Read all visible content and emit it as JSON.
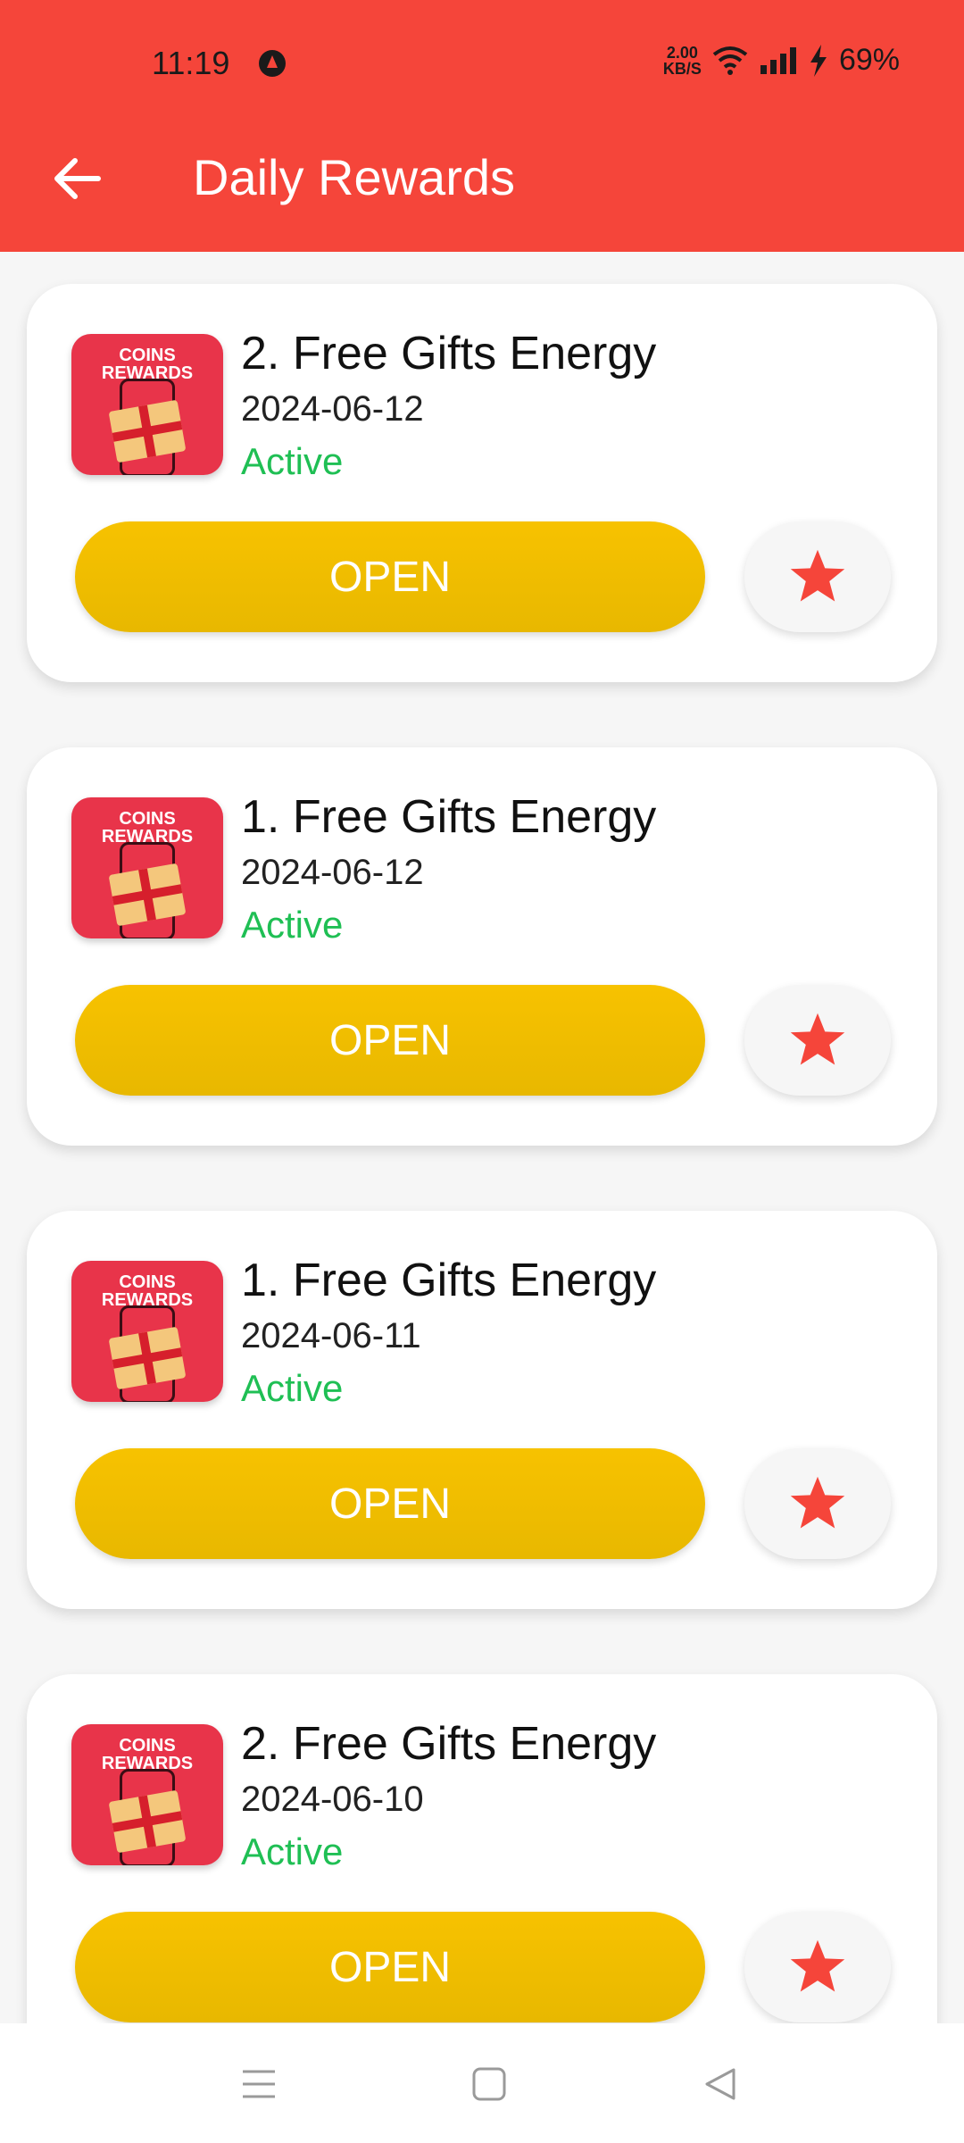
{
  "status_bar": {
    "time": "11:19",
    "net_speed_value": "2.00",
    "net_speed_unit": "KB/S",
    "battery": "69%"
  },
  "header": {
    "title": "Daily Rewards",
    "back_icon": "arrow-left-icon"
  },
  "thumbnail": {
    "line1": "COINS",
    "line2": "REWARDS"
  },
  "cards": [
    {
      "title": "2. Free Gifts Energy",
      "date": "2024-06-12",
      "status": "Active",
      "button": "OPEN"
    },
    {
      "title": "1. Free Gifts Energy",
      "date": "2024-06-12",
      "status": "Active",
      "button": "OPEN"
    },
    {
      "title": "1. Free Gifts Energy",
      "date": "2024-06-11",
      "status": "Active",
      "button": "OPEN"
    },
    {
      "title": "2. Free Gifts Energy",
      "date": "2024-06-10",
      "status": "Active",
      "button": "OPEN"
    }
  ],
  "colors": {
    "header_bg": "#f5453a",
    "open_button": "#f7c200",
    "status_active": "#1fbf54",
    "star": "#f5453a"
  },
  "navbar": {
    "icons": [
      "menu-icon",
      "home-square-icon",
      "back-triangle-icon"
    ]
  }
}
